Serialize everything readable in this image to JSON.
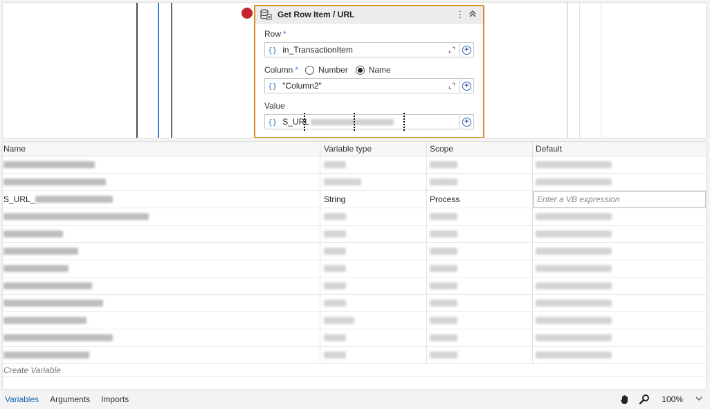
{
  "activity": {
    "title": "Get Row Item / URL",
    "menu_icon": "more-vertical-icon",
    "collapse_icon": "collapse-icon",
    "row_label": "Row",
    "row_required": "*",
    "row_value": "in_TransactionItem",
    "column_label": "Column",
    "column_required": "*",
    "column_options": [
      "Number",
      "Name"
    ],
    "column_selected": "Name",
    "column_value": "\"Column2\"",
    "value_label": "Value",
    "value_prefix": "S_URL"
  },
  "grid": {
    "headers": {
      "name": "Name",
      "type": "Variable type",
      "scope": "Scope",
      "default": "Default"
    },
    "active_row": {
      "name": "S_URL_",
      "type": "String",
      "scope": "Process",
      "default_placeholder": "Enter a VB expression"
    },
    "create_variable": "Create Variable"
  },
  "bottom_bar": {
    "tabs": [
      "Variables",
      "Arguments",
      "Imports"
    ],
    "active_tab": "Variables",
    "zoom": "100%",
    "icons": [
      "hand-icon",
      "zoom-search-icon",
      "chevron-down-icon"
    ]
  }
}
